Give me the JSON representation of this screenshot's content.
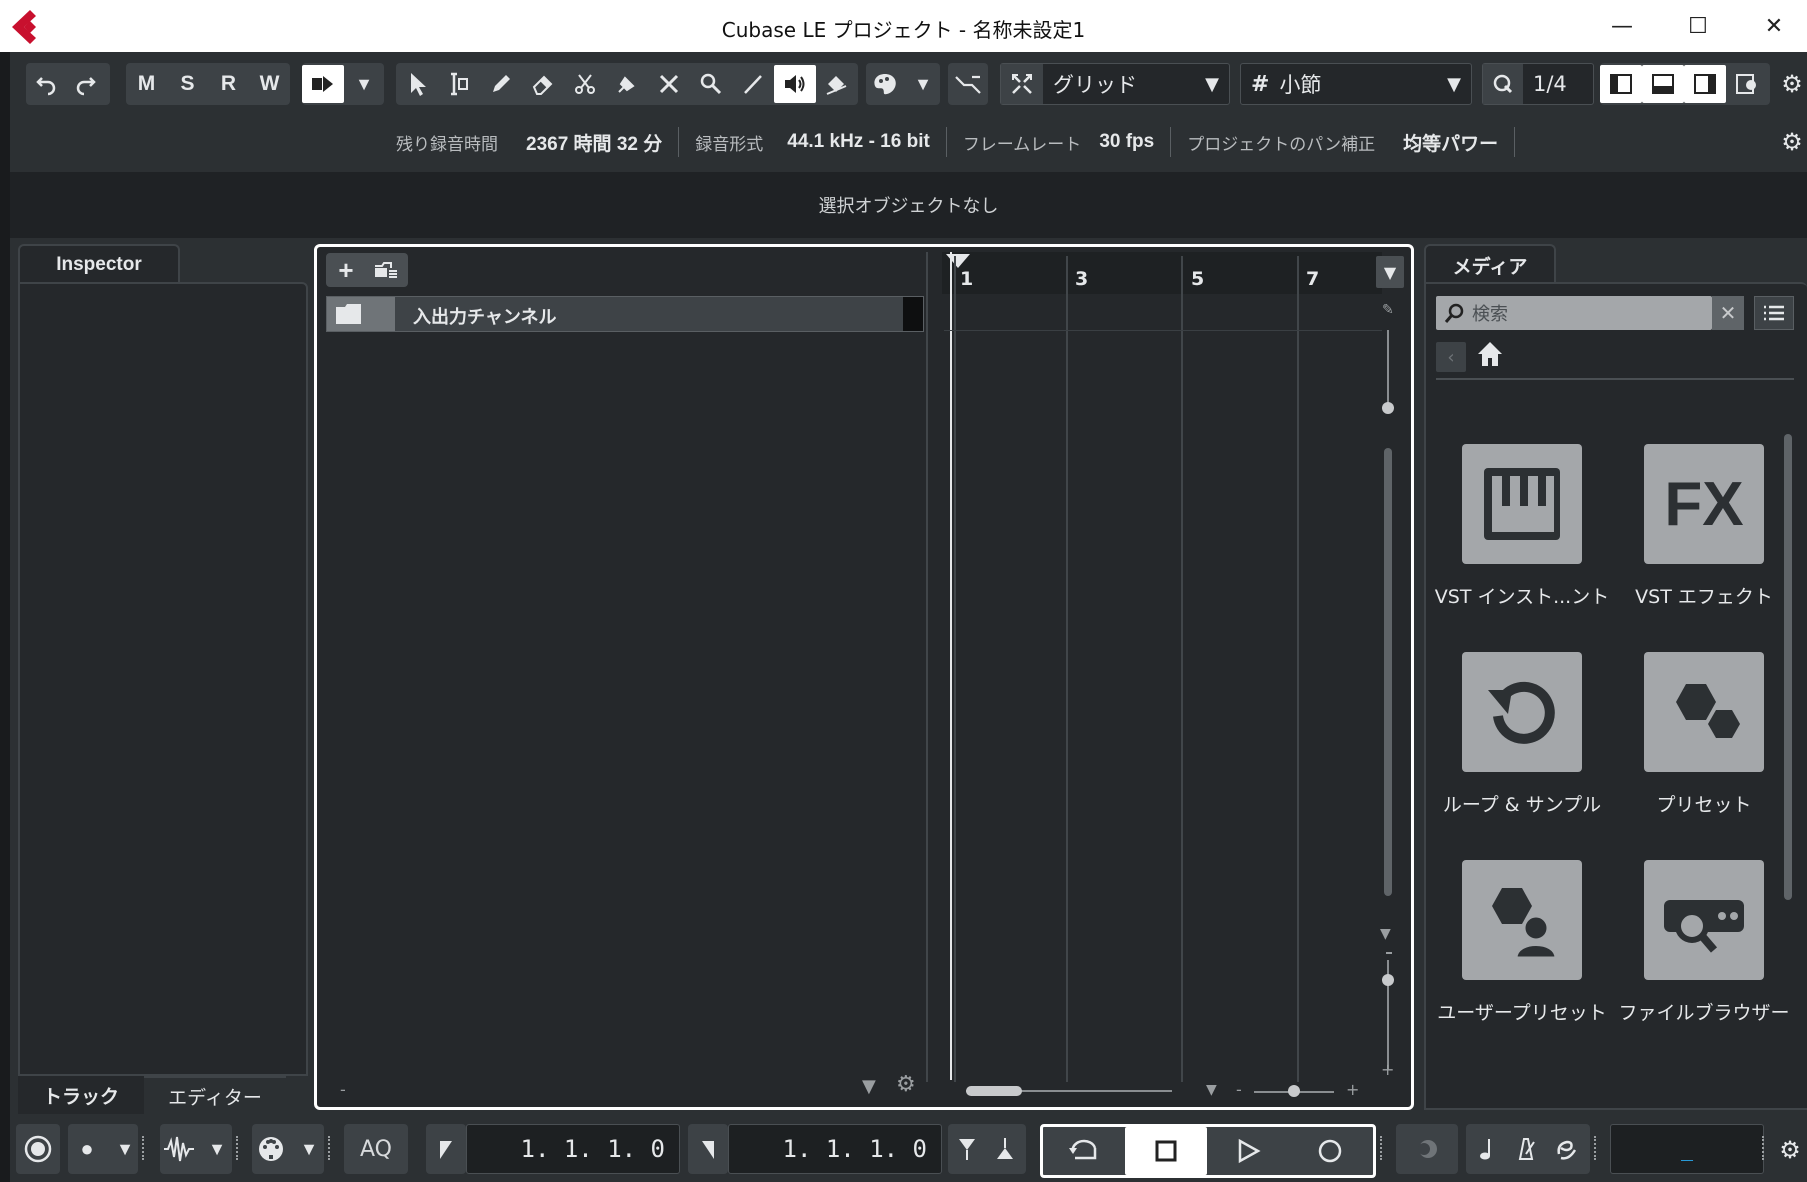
{
  "window": {
    "title": "Cubase LE プロジェクト - 名称未設定1",
    "minimize": "—",
    "maximize": "☐",
    "close": "✕"
  },
  "toolbar": {
    "mute_label": "M",
    "solo_label": "S",
    "read_label": "R",
    "write_label": "W",
    "snap_type": "グリッド",
    "grid_type": "小節",
    "quantize": "1/4"
  },
  "info": {
    "remaining_label": "残り録音時間",
    "remaining_value": "2367 時間 32 分",
    "format_label": "録音形式",
    "format_value": "44.1 kHz - 16 bit",
    "framerate_label": "フレームレート",
    "framerate_value": "30 fps",
    "pan_label": "プロジェクトのパン補正",
    "pan_value": "均等パワー"
  },
  "selection_text": "選択オブジェクトなし",
  "inspector": {
    "tab": "Inspector",
    "bottom_tabs": [
      "トラック",
      "エディター"
    ]
  },
  "track_list": {
    "tracks": [
      {
        "name": "入出力チャンネル"
      }
    ],
    "footer_dash": "-"
  },
  "ruler": {
    "bars": [
      "1",
      "3",
      "5",
      "7"
    ]
  },
  "media": {
    "tab": "メディア",
    "search_placeholder": "検索",
    "tiles": [
      {
        "label": "VST インスト...ント",
        "icon": "piano-icon"
      },
      {
        "label": "VST エフェクト",
        "icon": "fx-icon"
      },
      {
        "label": "ループ & サンプル",
        "icon": "loop-icon"
      },
      {
        "label": "プリセット",
        "icon": "hexagons-icon"
      },
      {
        "label": "ユーザープリセット",
        "icon": "user-preset-icon"
      },
      {
        "label": "ファイルブラウザー",
        "icon": "file-browser-icon"
      }
    ],
    "fx_text": "FX"
  },
  "transport": {
    "aq_label": "AQ",
    "left_locator": "1.  1.  1.    0",
    "right_locator": "1.  1.  1.    0",
    "time_display": "_"
  }
}
